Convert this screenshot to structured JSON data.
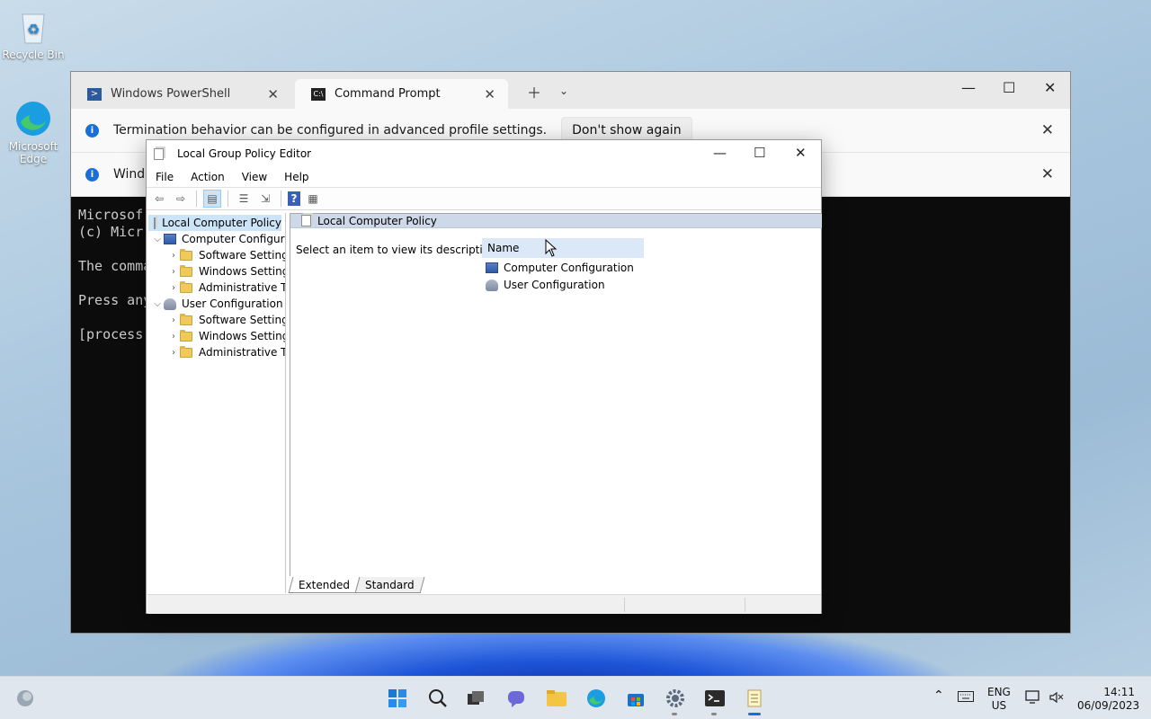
{
  "desktop": {
    "icons": [
      {
        "label": "Recycle Bin"
      },
      {
        "label": "Microsoft Edge"
      }
    ]
  },
  "terminal": {
    "tabs": [
      {
        "label": "Windows PowerShell"
      },
      {
        "label": "Command Prompt"
      }
    ],
    "infobars": [
      {
        "text": "Termination behavior can be configured in advanced profile settings.",
        "action": "Don't show again"
      },
      {
        "text": "Windo"
      }
    ],
    "console_lines": [
      "Microsof",
      "(c) Micr",
      "",
      "The comma",
      "",
      "Press any",
      "",
      "[process"
    ]
  },
  "gpe": {
    "title": "Local Group Policy Editor",
    "menu": [
      "File",
      "Action",
      "View",
      "Help"
    ],
    "tree": {
      "root": "Local Computer Policy",
      "computer": "Computer Configura",
      "computer_children": [
        "Software Settings",
        "Windows Setting",
        "Administrative Te"
      ],
      "user": "User Configuration",
      "user_children": [
        "Software Settings",
        "Windows Setting",
        "Administrative Te"
      ]
    },
    "right": {
      "header": "Local Computer Policy",
      "description": "Select an item to view its description.",
      "column": "Name",
      "items": [
        "Computer Configuration",
        "User Configuration"
      ]
    },
    "bottom_tabs": [
      "Extended",
      "Standard"
    ]
  },
  "taskbar": {
    "lang": "ENG",
    "region": "US",
    "time": "14:11",
    "date": "06/09/2023"
  }
}
